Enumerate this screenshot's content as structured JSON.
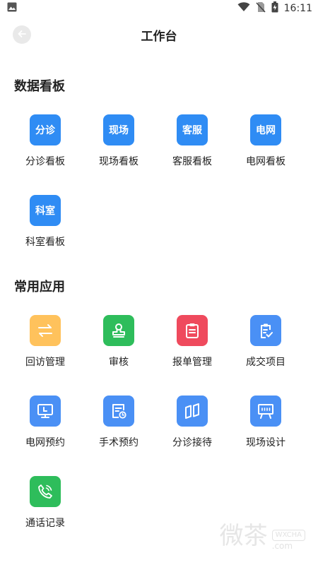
{
  "status_bar": {
    "time": "16:11"
  },
  "header": {
    "title": "工作台"
  },
  "sections": [
    {
      "title": "数据看板",
      "items": [
        {
          "label": "分诊看板",
          "icon_text": "分诊",
          "icon": "triage-text-icon"
        },
        {
          "label": "现场看板",
          "icon_text": "现场",
          "icon": "site-text-icon"
        },
        {
          "label": "客服看板",
          "icon_text": "客服",
          "icon": "service-text-icon"
        },
        {
          "label": "电网看板",
          "icon_text": "电网",
          "icon": "grid-text-icon"
        },
        {
          "label": "科室看板",
          "icon_text": "科室",
          "icon": "department-text-icon"
        }
      ]
    },
    {
      "title": "常用应用",
      "items": [
        {
          "label": "回访管理",
          "icon": "swap-arrows-icon"
        },
        {
          "label": "审核",
          "icon": "stamp-icon"
        },
        {
          "label": "报单管理",
          "icon": "clipboard-icon"
        },
        {
          "label": "成交项目",
          "icon": "clipboard-check-icon"
        },
        {
          "label": "电网预约",
          "icon": "monitor-icon"
        },
        {
          "label": "手术预约",
          "icon": "document-clock-icon"
        },
        {
          "label": "分诊接待",
          "icon": "map-fold-icon"
        },
        {
          "label": "现场设计",
          "icon": "presentation-board-icon"
        },
        {
          "label": "通话记录",
          "icon": "phone-icon"
        }
      ]
    }
  ],
  "watermark": {
    "text": "微茶",
    "badge": "WXCHA",
    "domain": ".com"
  },
  "colors": {
    "accent_blue": "#2f8cf4",
    "icon_blue": "#4a90f5",
    "orange": "#ffc25c",
    "green": "#2ebd5b",
    "red": "#ef4a5d"
  }
}
